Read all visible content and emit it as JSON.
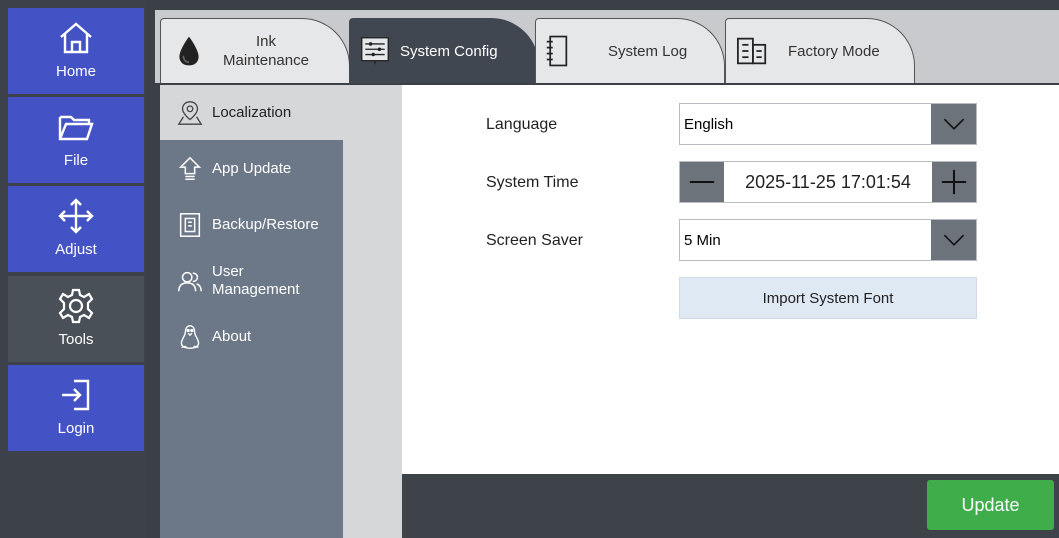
{
  "nav": {
    "home": "Home",
    "file": "File",
    "adjust": "Adjust",
    "tools": "Tools",
    "login": "Login"
  },
  "tabs": {
    "ink_line1": "Ink",
    "ink_line2": "Maintenance",
    "system_config": "System Config",
    "system_log": "System Log",
    "factory_mode": "Factory Mode"
  },
  "side": {
    "localization": "Localization",
    "app_update": "App Update",
    "backup_restore": "Backup/Restore",
    "user_line1": "User",
    "user_line2": "Management",
    "about": "About"
  },
  "form": {
    "language_label": "Language",
    "language_value": "English",
    "time_label": "System Time",
    "time_value": "2025-11-25 17:01:54",
    "saver_label": "Screen Saver",
    "saver_value": "5 Min",
    "import_font": "Import System Font"
  },
  "footer": {
    "update": "Update"
  },
  "colors": {
    "nav_blue": "#4352c4",
    "nav_active": "#4a5058",
    "update_green": "#3fae4a"
  }
}
